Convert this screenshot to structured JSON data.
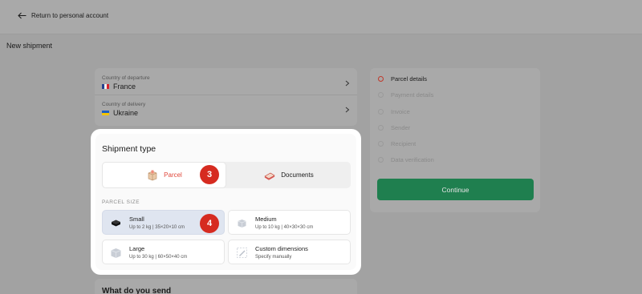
{
  "header": {
    "back_label": "Return to personal account"
  },
  "page": {
    "title": "New shipment"
  },
  "route": {
    "departure": {
      "label": "Country of departure",
      "value": "France",
      "flag": "fr"
    },
    "delivery": {
      "label": "Country of delivery",
      "value": "Ukraine",
      "flag": "ua"
    }
  },
  "modal": {
    "title": "Shipment type",
    "type_options": [
      {
        "label": "Parcel",
        "selected": true,
        "icon": "parcel-box-icon"
      },
      {
        "label": "Documents",
        "selected": false,
        "icon": "documents-icon"
      }
    ],
    "step_badges": [
      "3",
      "4"
    ],
    "section_label": "PARCEL SIZE",
    "sizes": [
      {
        "name": "Small",
        "desc": "Up to 2 kg | 35×20×10 cm",
        "selected": true,
        "icon": "small-box-icon"
      },
      {
        "name": "Medium",
        "desc": "Up to 10 kg | 40×30×30 cm",
        "selected": false,
        "icon": "medium-box-icon"
      },
      {
        "name": "Large",
        "desc": "Up to 30 kg | 60×50×40 cm",
        "selected": false,
        "icon": "large-box-icon"
      },
      {
        "name": "Custom dimensions",
        "desc": "Specify manually",
        "selected": false,
        "icon": "pencil-icon"
      }
    ]
  },
  "next_section": {
    "title": "What do you send"
  },
  "steps": {
    "items": [
      {
        "label": "Parcel details",
        "active": true
      },
      {
        "label": "Payment details",
        "active": false
      },
      {
        "label": "Invoice",
        "active": false
      },
      {
        "label": "Sender",
        "active": false
      },
      {
        "label": "Recipient",
        "active": false
      },
      {
        "label": "Data verification",
        "active": false
      }
    ],
    "continue_label": "Continue"
  },
  "colors": {
    "accent_red": "#d62b20",
    "continue_green": "#1f7f4f",
    "overlay": "#a2a2a2"
  }
}
